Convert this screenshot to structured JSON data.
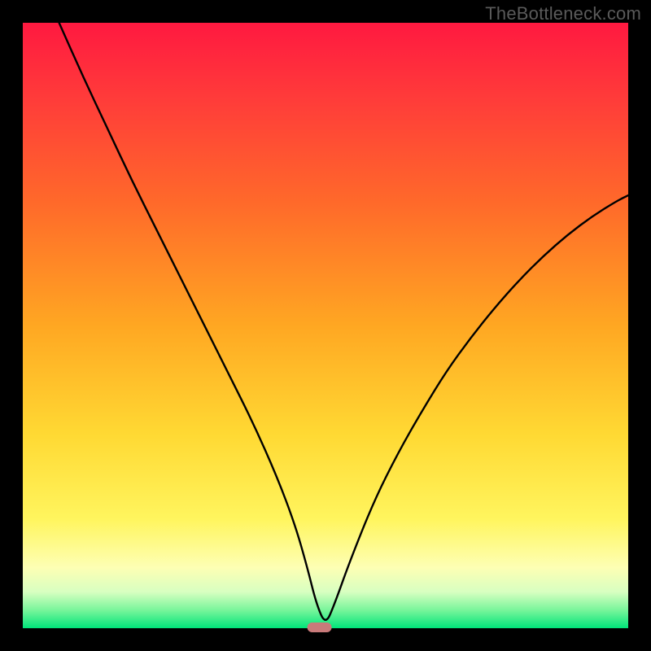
{
  "watermark": "TheBottleneck.com",
  "chart_data": {
    "type": "line",
    "title": "",
    "xlabel": "",
    "ylabel": "",
    "xlim": [
      0,
      100
    ],
    "ylim": [
      0,
      100
    ],
    "grid": false,
    "legend": false,
    "background": {
      "description": "Vertical gradient from red (top) through orange and yellow to pale yellow then green (bottom), drawn inside a black frame.",
      "stops": [
        {
          "offset": 0.0,
          "color": "#ff1940"
        },
        {
          "offset": 0.12,
          "color": "#ff3a3a"
        },
        {
          "offset": 0.3,
          "color": "#ff6a2a"
        },
        {
          "offset": 0.5,
          "color": "#ffa722"
        },
        {
          "offset": 0.68,
          "color": "#ffd933"
        },
        {
          "offset": 0.82,
          "color": "#fff55e"
        },
        {
          "offset": 0.9,
          "color": "#fdffb4"
        },
        {
          "offset": 0.94,
          "color": "#d8ffc1"
        },
        {
          "offset": 0.97,
          "color": "#79f59b"
        },
        {
          "offset": 1.0,
          "color": "#00e57a"
        }
      ]
    },
    "marker": {
      "x": 49,
      "y": 0,
      "color": "#c97a7a",
      "shape": "rounded-rect"
    },
    "series": [
      {
        "name": "curve",
        "color": "#000000",
        "stroke_width": 2.4,
        "x": [
          6,
          10,
          14,
          18,
          22,
          26,
          30,
          34,
          38,
          42,
          45,
          47,
          48.5,
          50,
          51.5,
          54,
          58,
          62,
          66,
          70,
          74,
          78,
          82,
          86,
          90,
          94,
          98,
          100
        ],
        "y": [
          100,
          91,
          82.5,
          74,
          66,
          58,
          50,
          42,
          34,
          25,
          17,
          10,
          4,
          0.5,
          4,
          11,
          21,
          29,
          36,
          42.5,
          48,
          53,
          57.5,
          61.5,
          65,
          68,
          70.5,
          71.5
        ]
      }
    ]
  }
}
